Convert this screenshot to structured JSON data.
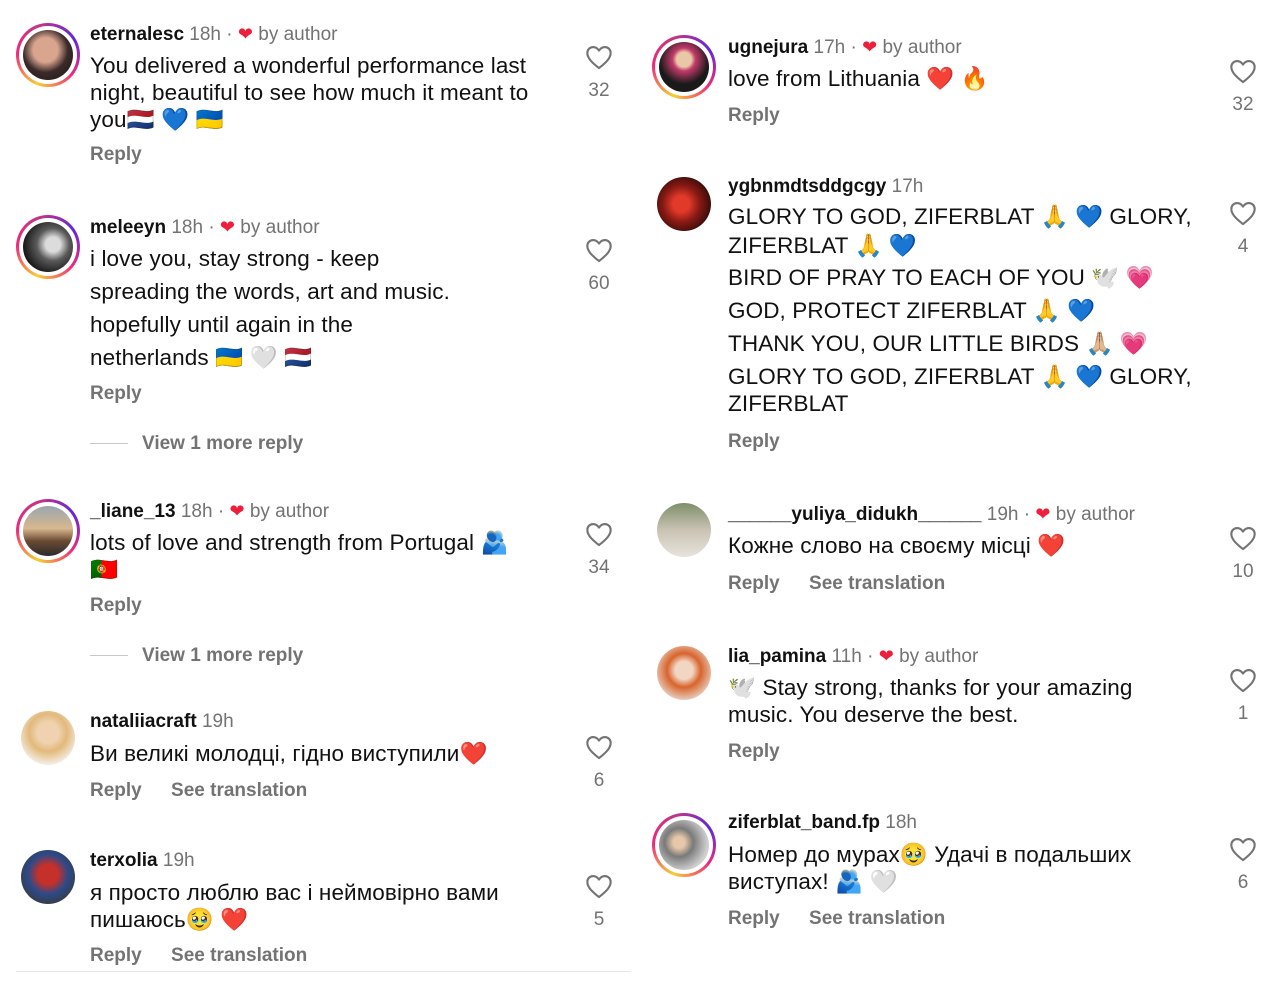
{
  "labels": {
    "reply": "Reply",
    "see_translation": "See translation",
    "by_author": "by author",
    "view_more": "View 1 more reply"
  },
  "colors": {
    "author_heart": "#ed1f3b",
    "muted_text": "#737373"
  },
  "comments": [
    {
      "username": "eternalesc",
      "time": "18h",
      "liked_by_author": true,
      "lines": [
        "You delivered a wonderful performance last",
        "night, beautiful to see how much it meant to",
        "you🇳🇱 💙 🇺🇦"
      ],
      "likes": "32"
    },
    {
      "username": "meleeyn",
      "time": "18h",
      "liked_by_author": true,
      "lines": [
        "i love you, stay strong - keep",
        "spreading the words, art and music.",
        "hopefully until again in the",
        "netherlands 🇺🇦 🤍 🇳🇱"
      ],
      "likes": "60"
    },
    {
      "username": "_liane_13",
      "time": "18h",
      "liked_by_author": true,
      "lines": [
        "lots of love and strength from Portugal 🫂",
        "🇵🇹"
      ],
      "likes": "34"
    },
    {
      "username": "nataliiacraft",
      "time": "19h",
      "liked_by_author": false,
      "lines": [
        "Ви великі молодці, гідно виступили❤️"
      ],
      "likes": "6"
    },
    {
      "username": "terxolia",
      "time": "19h",
      "liked_by_author": false,
      "lines": [
        "я просто люблю вас і неймовірно вами",
        "пишаюсь🥹 ❤️"
      ],
      "likes": "5"
    },
    {
      "username": "ugnejura",
      "time": "17h",
      "liked_by_author": true,
      "lines": [
        "love from Lithuania ❤️ 🔥"
      ],
      "likes": "32"
    },
    {
      "username": "ygbnmdtsddgcgy",
      "time": "17h",
      "liked_by_author": false,
      "lines": [
        "GLORY TO GOD, ZIFERBLAT 🙏 💙 GLORY,",
        "ZIFERBLAT 🙏 💙",
        "BIRD OF PRAY TO EACH OF YOU 🕊️ 💗",
        "GOD, PROTECT ZIFERBLAT 🙏 💙",
        "THANK YOU, OUR LITTLE BIRDS 🙏🏼 💗",
        "GLORY TO GOD, ZIFERBLAT 🙏 💙 GLORY,",
        "ZIFERBLAT"
      ],
      "likes": "4"
    },
    {
      "username": "______yuliya_didukh______",
      "time": "19h",
      "liked_by_author": true,
      "lines": [
        "Кожне слово на своєму місці ❤️"
      ],
      "likes": "10"
    },
    {
      "username": "lia_pamina",
      "time": "11h",
      "liked_by_author": true,
      "lines": [
        "🕊️  Stay strong, thanks for your amazing",
        "music.  You deserve the best."
      ],
      "likes": "1"
    },
    {
      "username": "ziferblat_band.fp",
      "time": "18h",
      "liked_by_author": false,
      "lines": [
        "Номер до мурах🥹  Удачі в подальших",
        "виступах! 🫂 🤍"
      ],
      "likes": "6"
    }
  ]
}
